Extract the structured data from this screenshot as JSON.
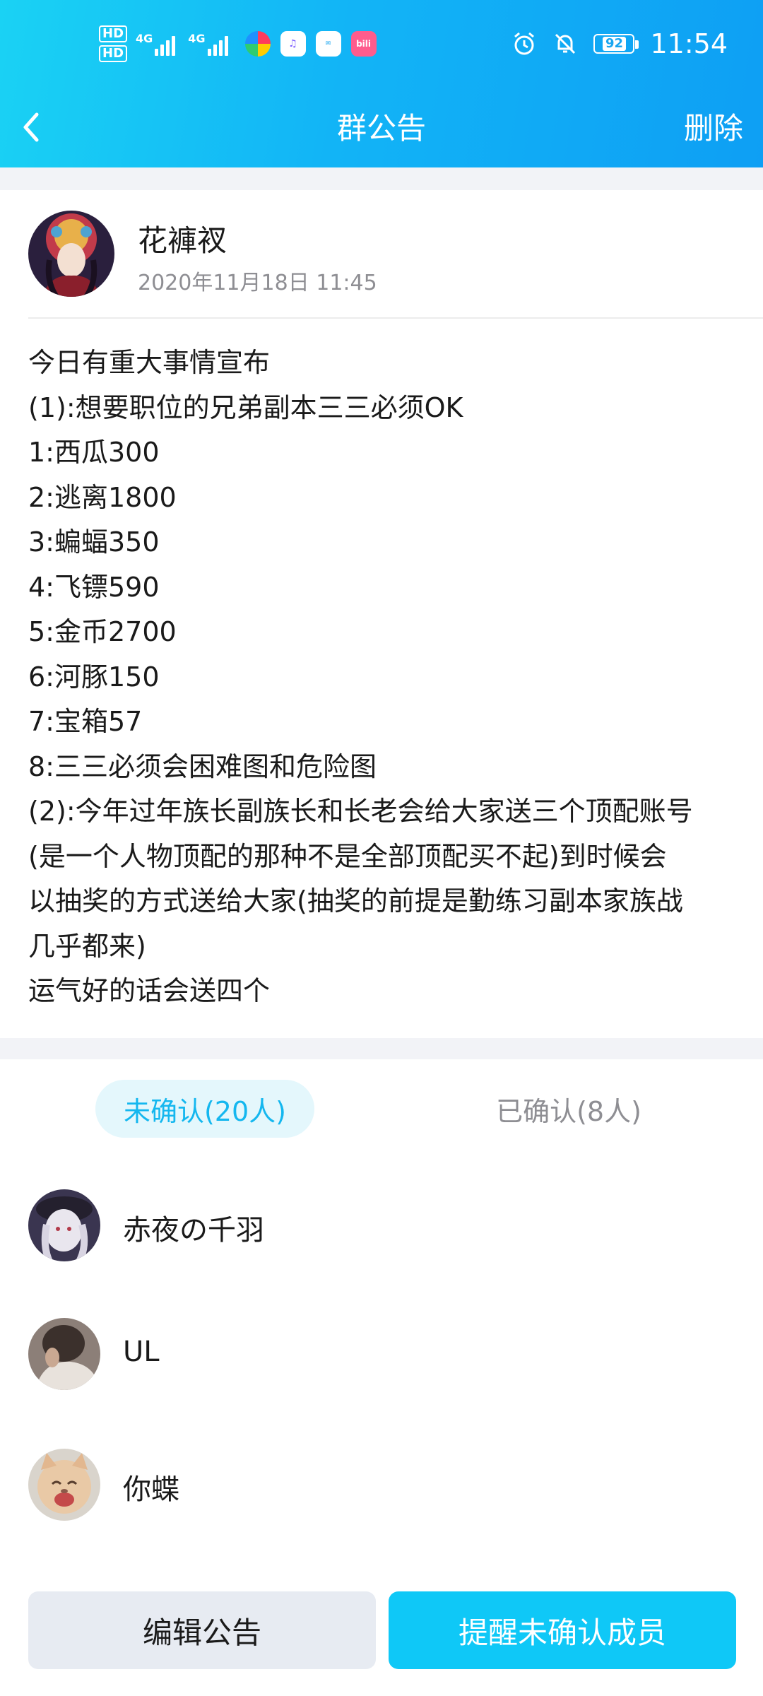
{
  "status_bar": {
    "hd1": "HD",
    "hd2": "HD",
    "net1": "4G",
    "net2": "4G",
    "battery": "92",
    "time": "11:54",
    "app_icons": [
      "colorful-ball-app",
      "music-app",
      "huawei-app",
      "bilibili-app"
    ]
  },
  "nav": {
    "title": "群公告",
    "delete_label": "删除"
  },
  "announcement": {
    "author": "花褲衩",
    "timestamp": "2020年11月18日 11:45",
    "lines": [
      "今日有重大事情宣布",
      "(1):想要职位的兄弟副本三三必须OK",
      "1:西瓜300",
      "2:逃离1800",
      "3:蝙蝠350",
      "4:飞镖590",
      "5:金币2700",
      "6:河豚150",
      "7:宝箱57",
      "8:三三必须会困难图和危险图",
      "(2):今年过年族长副族长和长老会给大家送三个顶配账号",
      "(是一个人物顶配的那种不是全部顶配买不起)到时候会",
      "以抽奖的方式送给大家(抽奖的前提是勤练习副本家族战",
      "几乎都来)",
      "运气好的话会送四个"
    ]
  },
  "tabs": {
    "unconfirmed": "未确认(20人)",
    "confirmed": "已确认(8人)"
  },
  "members": [
    {
      "name": "赤夜の千羽"
    },
    {
      "name": "UL"
    },
    {
      "name": "你蝶"
    }
  ],
  "buttons": {
    "edit": "编辑公告",
    "remind": "提醒未确认成员"
  },
  "colors": {
    "accent": "#0fc8f7",
    "header_start": "#1ad2f4",
    "header_end": "#0e9ff4",
    "tab_active_text": "#14b7ef"
  }
}
